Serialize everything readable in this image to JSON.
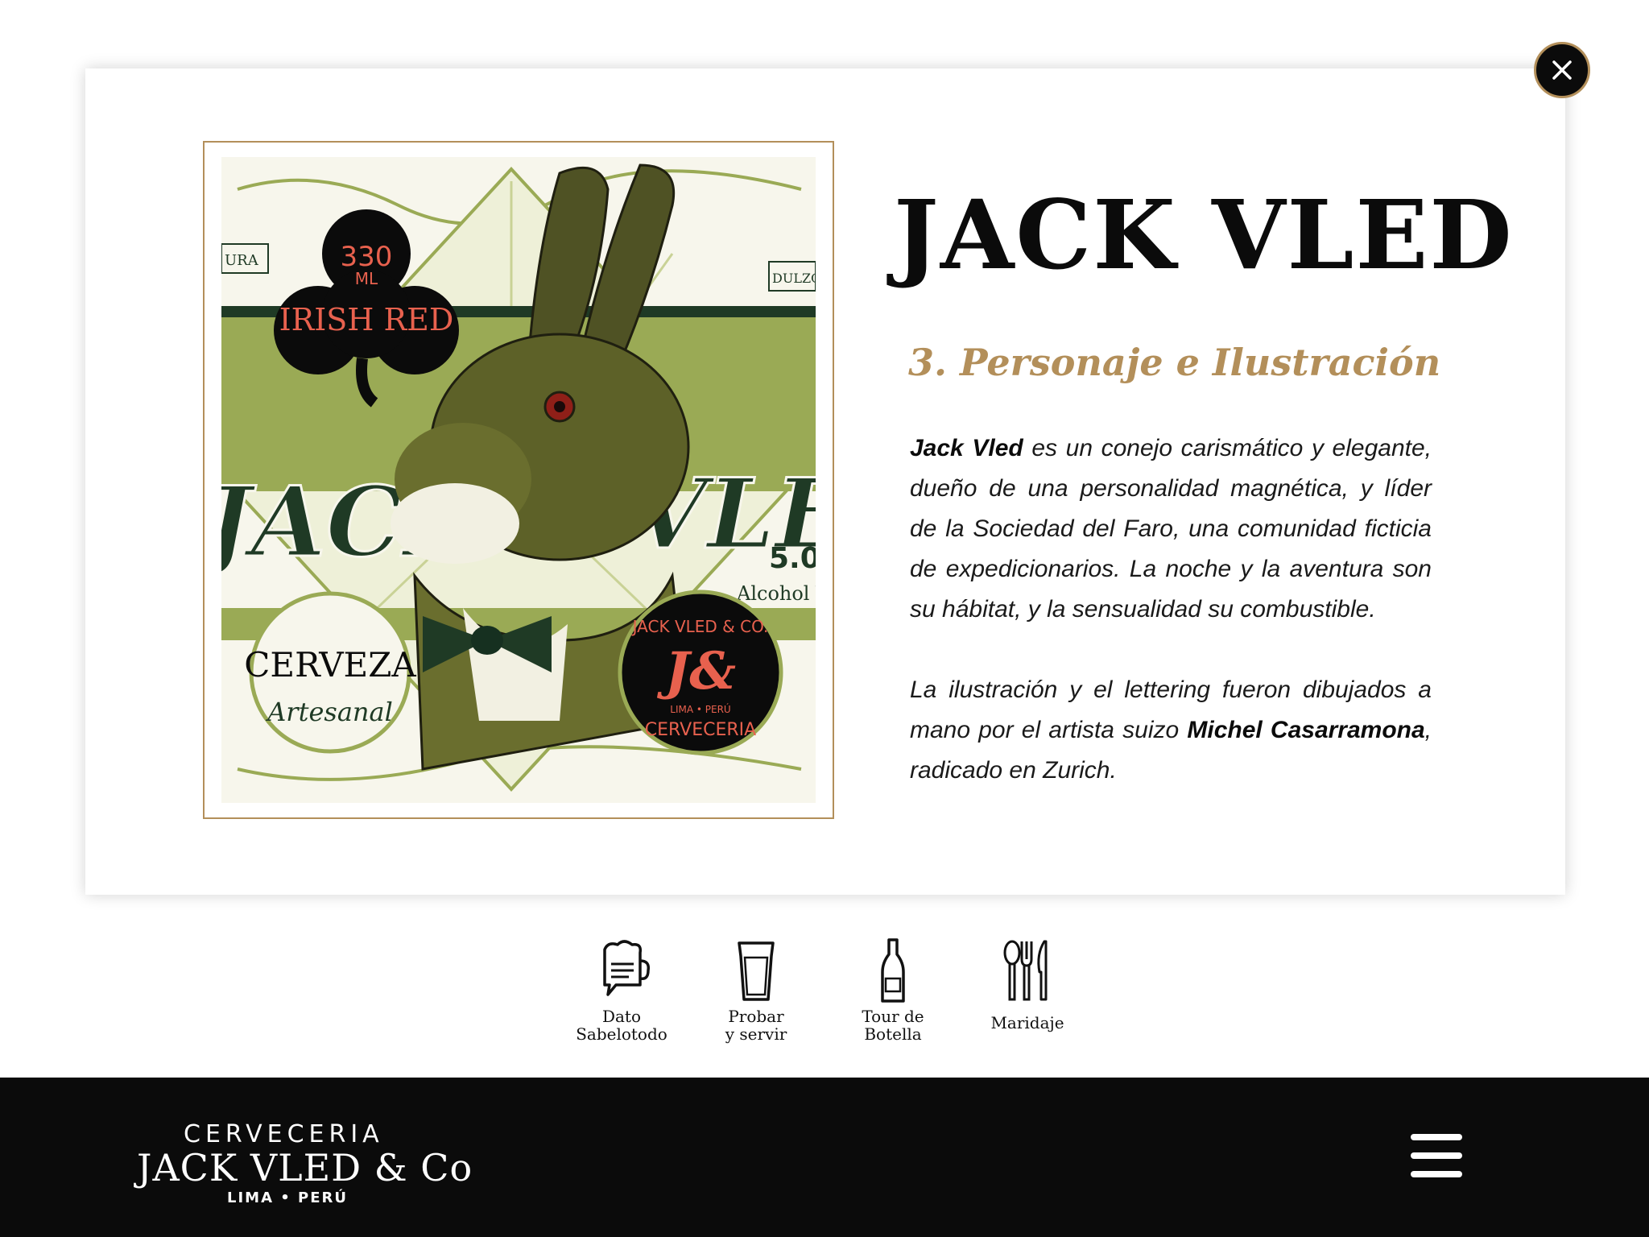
{
  "modal": {
    "close_label": "×",
    "brand_title": "JACK VLED",
    "section_title": "3. Personaje e Ilustración",
    "paragraph1": {
      "name": "Jack Vled",
      "text": " es un conejo carismático y elegante, dueño de una personalidad magnética, y líder de la Sociedad del Faro, una comunidad ficticia de expedicionarios. La noche y la aventura son su hábitat, y la sensualidad su combustible."
    },
    "paragraph2": {
      "text_before": "La ilustración y el lettering fueron dibujados a mano por el artista suizo ",
      "artist": "Michel Casarramona",
      "text_after": ", radicado en Zurich."
    },
    "label": {
      "volume": "330",
      "unit": "ML",
      "style": "IRISH RED",
      "left_ribbon": "URA",
      "right_ribbon": "DULZOR",
      "brand_left": "JACK",
      "brand_right": "VLED",
      "abv": "5.0",
      "abv_label": "Alcohol V",
      "cerveza": "CERVEZA",
      "artesanal": "Artesanal",
      "seal_top": "JACK VLED & CO.",
      "seal_mid": "LIMA • PERÚ",
      "seal_bottom": "CERVECERIA"
    }
  },
  "nav": [
    {
      "label": "Dato\nSabelotodo",
      "icon": "beer-mug-speech-icon"
    },
    {
      "label": "Probar\ny servir",
      "icon": "pint-glass-icon"
    },
    {
      "label": "Tour de\nBotella",
      "icon": "bottle-icon"
    },
    {
      "label": "Maridaje",
      "icon": "cutlery-icon"
    }
  ],
  "footer": {
    "logo_top": "CERVECERIA",
    "logo_main": "JACK VLED & Co",
    "logo_sub": "LIMA • PERÚ",
    "menu_icon": "hamburger-menu-icon"
  },
  "colors": {
    "accent": "#b38f5a",
    "footer_bg": "#0b0b0b",
    "label_green": "#9aaa55",
    "label_dark_green": "#1f3a25",
    "label_coral": "#e8614e"
  }
}
